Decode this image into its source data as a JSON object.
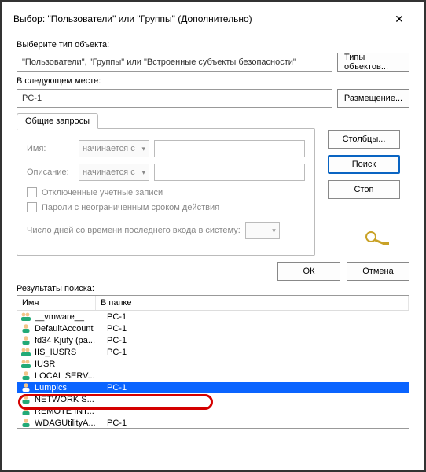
{
  "titlebar": {
    "title": "Выбор: \"Пользователи\" или \"Группы\" (Дополнительно)",
    "close": "✕"
  },
  "labels": {
    "obj_type": "Выберите тип объекта:",
    "obj_value": "\"Пользователи\", \"Группы\" или \"Встроенные субъекты безопасности\"",
    "btn_types": "Типы объектов...",
    "location_label": "В следующем месте:",
    "location_value": "PC-1",
    "btn_location": "Размещение...",
    "tab_common": "Общие запросы",
    "name_label": "Имя:",
    "name_combo": "начинается с",
    "desc_label": "Описание:",
    "desc_combo": "начинается с",
    "chk_disabled": "Отключенные учетные записи",
    "chk_nonexp": "Пароли с неограниченным сроком действия",
    "days_label": "Число дней со времени последнего входа в систему:",
    "btn_columns": "Столбцы...",
    "btn_search": "Поиск",
    "btn_stop": "Стоп",
    "btn_ok": "ОК",
    "btn_cancel": "Отмена",
    "results_label": "Результаты поиска:",
    "col_name": "Имя",
    "col_folder": "В папке"
  },
  "results": [
    {
      "name": "__vmware__",
      "folder": "PC-1",
      "icon": "group"
    },
    {
      "name": "DefaultAccount",
      "folder": "PC-1",
      "icon": "user"
    },
    {
      "name": "fd34 Kjufy (pa...",
      "folder": "PC-1",
      "icon": "user"
    },
    {
      "name": "IIS_IUSRS",
      "folder": "PC-1",
      "icon": "group"
    },
    {
      "name": "IUSR",
      "folder": "",
      "icon": "group"
    },
    {
      "name": "LOCAL SERV...",
      "folder": "",
      "icon": "user"
    },
    {
      "name": "Lumpics",
      "folder": "PC-1",
      "icon": "user",
      "selected": true
    },
    {
      "name": "NETWORK S...",
      "folder": "",
      "icon": "user"
    },
    {
      "name": "REMOTE INT...",
      "folder": "",
      "icon": "user"
    },
    {
      "name": "WDAGUtilityA...",
      "folder": "PC-1",
      "icon": "user"
    }
  ]
}
